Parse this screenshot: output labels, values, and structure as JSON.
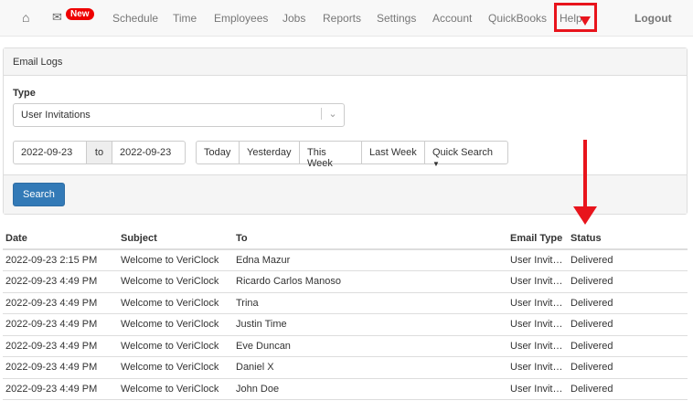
{
  "nav": {
    "new_badge": "New",
    "items": [
      "Schedule",
      "Time",
      "Employees",
      "Jobs",
      "Reports",
      "Settings",
      "Account",
      "QuickBooks",
      "Help"
    ],
    "logout": "Logout"
  },
  "panel": {
    "title": "Email Logs",
    "type_label": "Type",
    "type_value": "User Invitations",
    "date_from": "2022-09-23",
    "to_label": "to",
    "date_to": "2022-09-23",
    "ranges": [
      "Today",
      "Yesterday",
      "This Week",
      "Last Week",
      "Quick Search"
    ],
    "search": "Search"
  },
  "table": {
    "headers": [
      "Date",
      "Subject",
      "To",
      "Email Type",
      "Status"
    ],
    "rows": [
      [
        "2022-09-23 2:15 PM",
        "Welcome to VeriClock",
        "Edna Mazur",
        "User Invit…",
        "Delivered"
      ],
      [
        "2022-09-23 4:49 PM",
        "Welcome to VeriClock",
        "Ricardo Carlos Manoso",
        "User Invit…",
        "Delivered"
      ],
      [
        "2022-09-23 4:49 PM",
        "Welcome to VeriClock",
        "Trina",
        "User Invit…",
        "Delivered"
      ],
      [
        "2022-09-23 4:49 PM",
        "Welcome to VeriClock",
        "Justin Time",
        "User Invit…",
        "Delivered"
      ],
      [
        "2022-09-23 4:49 PM",
        "Welcome to VeriClock",
        "Eve Duncan",
        "User Invit…",
        "Delivered"
      ],
      [
        "2022-09-23 4:49 PM",
        "Welcome to VeriClock",
        "Daniel X",
        "User Invit…",
        "Delivered"
      ],
      [
        "2022-09-23 4:49 PM",
        "Welcome to VeriClock",
        "John Doe",
        "User Invit…",
        "Delivered"
      ]
    ]
  },
  "annotation_color": "#e8141c"
}
